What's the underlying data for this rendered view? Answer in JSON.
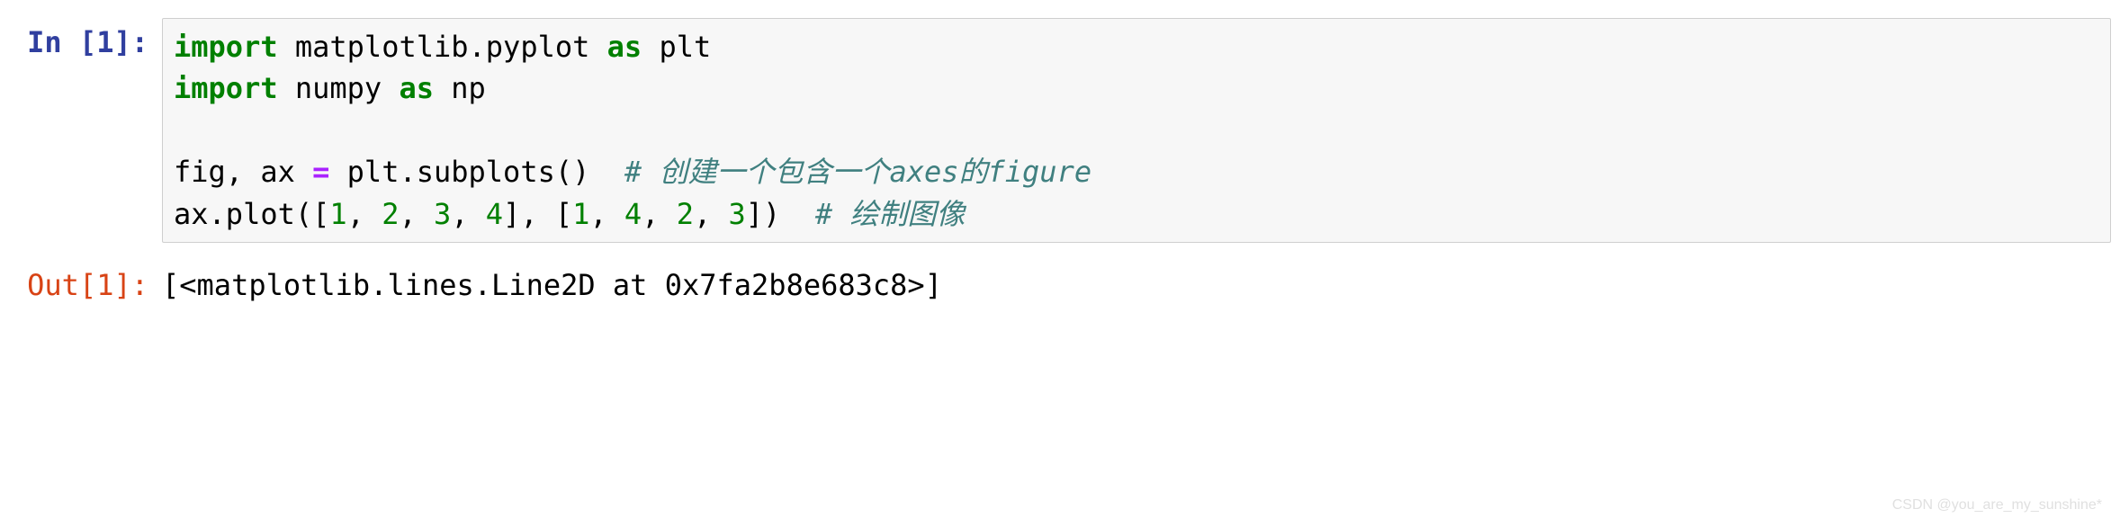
{
  "input": {
    "prompt": "In [1]:",
    "code": {
      "l1_kw1": "import",
      "l1_mod": " matplotlib.pyplot ",
      "l1_kw2": "as",
      "l1_alias": " plt",
      "l2_kw1": "import",
      "l2_mod": " numpy ",
      "l2_kw2": "as",
      "l2_alias": " np",
      "l4_pre": "fig, ax ",
      "l4_op": "=",
      "l4_call": " plt.subplots()  ",
      "l4_comment": "# 创建一个包含一个axes的figure",
      "l5_pre": "ax.plot([",
      "l5_n1": "1",
      "l5_c1": ", ",
      "l5_n2": "2",
      "l5_c2": ", ",
      "l5_n3": "3",
      "l5_c3": ", ",
      "l5_n4": "4",
      "l5_mid": "], [",
      "l5_n5": "1",
      "l5_c4": ", ",
      "l5_n6": "4",
      "l5_c5": ", ",
      "l5_n7": "2",
      "l5_c6": ", ",
      "l5_n8": "3",
      "l5_end": "])  ",
      "l5_comment": "# 绘制图像"
    }
  },
  "output": {
    "prompt": "Out[1]:",
    "text": "[<matplotlib.lines.Line2D at 0x7fa2b8e683c8>]"
  },
  "watermark": "CSDN @you_are_my_sunshine*"
}
